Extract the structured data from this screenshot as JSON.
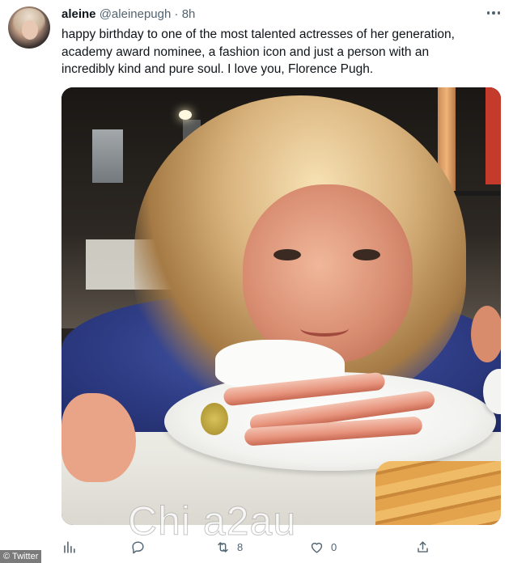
{
  "tweet": {
    "display_name": "aleine",
    "handle": "@aleinepugh",
    "separator": "·",
    "time": "8h",
    "text_lines": [
      "happy birthday to one of the most talented actresses of her generation,",
      "academy award nominee, a fashion icon and just a person with an",
      "incredibly kind and pure soul. I love you, Florence Pugh."
    ]
  },
  "actions": {
    "reply_count": "",
    "retweet_count": "8",
    "like_count": "0"
  },
  "icons": {
    "more": "more-dots-icon",
    "analytics": "bar-chart-icon",
    "reply": "reply-icon",
    "retweet": "retweet-icon",
    "like": "heart-icon",
    "share": "share-icon"
  },
  "colors": {
    "text": "#0f1419",
    "secondary": "#536471",
    "background": "#ffffff"
  },
  "overlay": {
    "watermark": "Chi    a2au",
    "credit": "© Twitter"
  }
}
